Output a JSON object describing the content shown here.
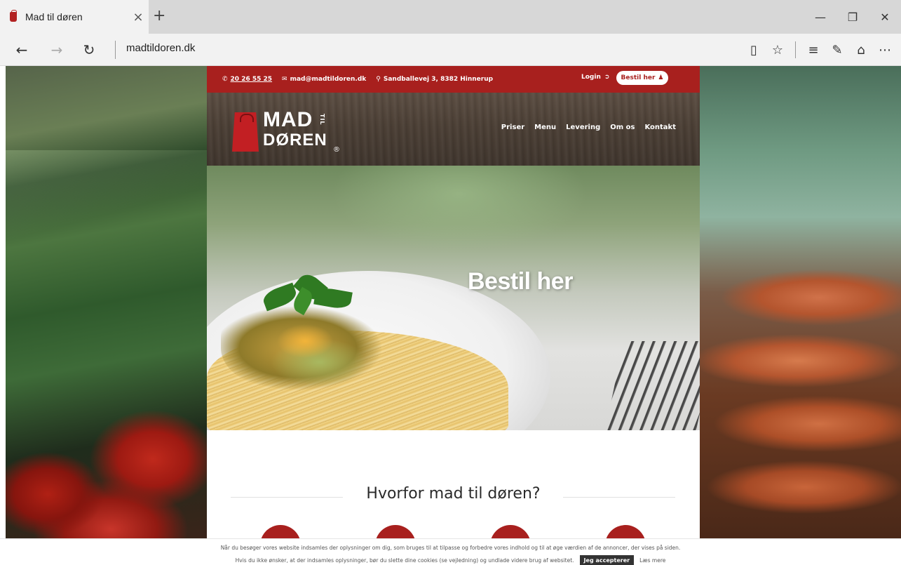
{
  "browser": {
    "tab_title": "Mad til døren",
    "tab_close": "×",
    "new_tab": "+",
    "address": "madtildoren.dk",
    "nav": {
      "back": "←",
      "forward": "→",
      "refresh": "↻"
    },
    "window": {
      "minimize": "—",
      "restore": "❐",
      "close": "✕"
    },
    "toolbar": {
      "reading_view": "▯",
      "favorites": "☆",
      "hub": "≡",
      "notes": "✎",
      "share": "⌂",
      "more": "⋯"
    }
  },
  "topbar": {
    "phone": "20 26 55 25",
    "email": "mad@madtildoren.dk",
    "address": "Sandballevej 3, 8382 Hinnerup",
    "login": "Login",
    "order_button": "Bestil her"
  },
  "logo": {
    "line1": "MAD",
    "til": "TIL",
    "line2": "DØREN",
    "reg": "®"
  },
  "nav": {
    "items": [
      "Priser",
      "Menu",
      "Levering",
      "Om os",
      "Kontakt"
    ]
  },
  "hero": {
    "title": "Bestil her"
  },
  "section": {
    "title": "Hvorfor mad til døren?"
  },
  "cookie": {
    "line1": "Når du besøger vores website indsamles der oplysninger om dig, som bruges til at tilpasse og forbedre vores indhold og til at øge værdien af de annoncer, der vises på siden.",
    "line2": "Hvis du ikke ønsker, at der indsamles oplysninger, bør du slette dine cookies (se vejledning) og undlade videre brug af websitet.",
    "accept": "Jeg accepterer",
    "read_more": "Læs mere"
  },
  "colors": {
    "brand_red": "#a8201e",
    "logo_red": "#c21f23",
    "wood": "#4b3f35"
  }
}
